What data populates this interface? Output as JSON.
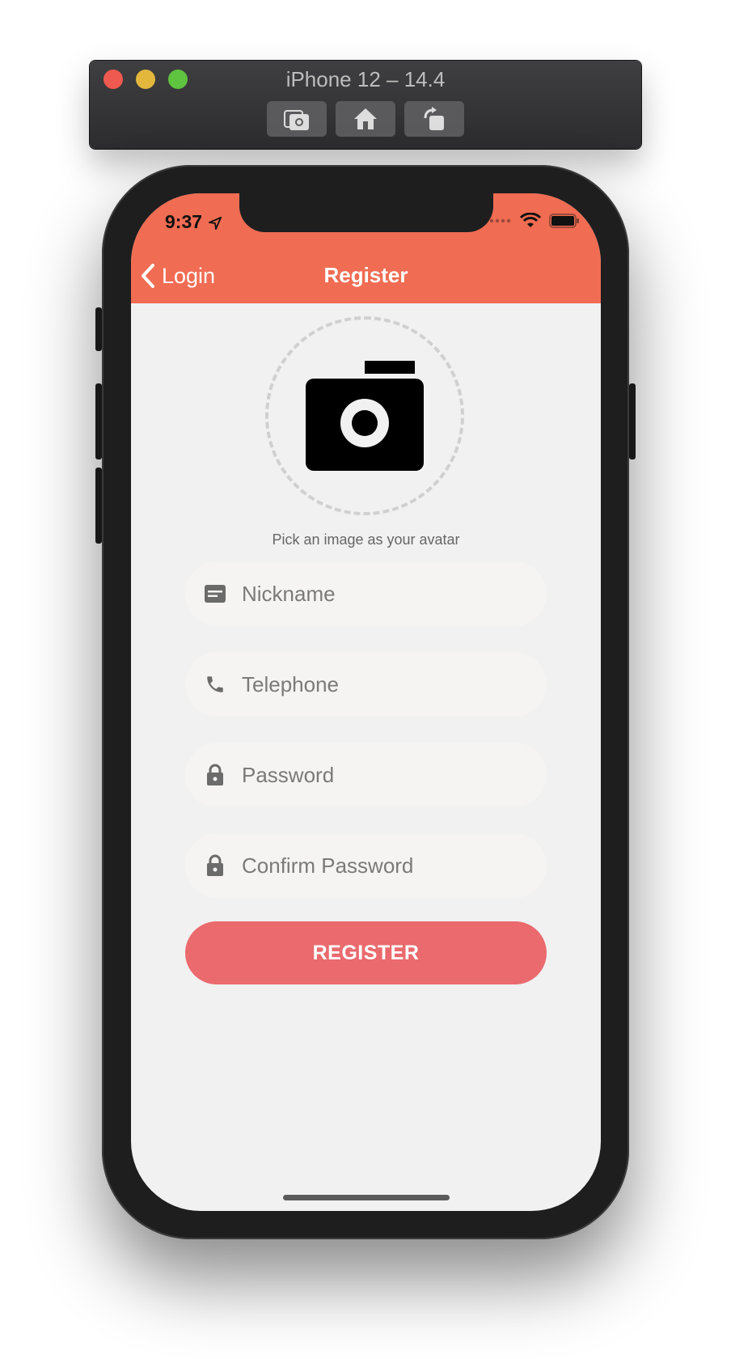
{
  "simulator": {
    "title": "iPhone 12 – 14.4",
    "buttons": [
      "screenshot-icon",
      "home-icon",
      "rotate-icon"
    ]
  },
  "status_bar": {
    "time": "9:37"
  },
  "nav": {
    "back_label": "Login",
    "title": "Register"
  },
  "avatar": {
    "hint": "Pick an image as your avatar"
  },
  "form": {
    "nickname": {
      "placeholder": "Nickname",
      "value": ""
    },
    "telephone": {
      "placeholder": "Telephone",
      "value": ""
    },
    "password": {
      "placeholder": "Password",
      "value": ""
    },
    "confirm_password": {
      "placeholder": "Confirm Password",
      "value": ""
    },
    "submit_label": "REGISTER"
  },
  "colors": {
    "header": "#f06c52",
    "button": "#ea6a6d",
    "background": "#f1f1f1"
  }
}
